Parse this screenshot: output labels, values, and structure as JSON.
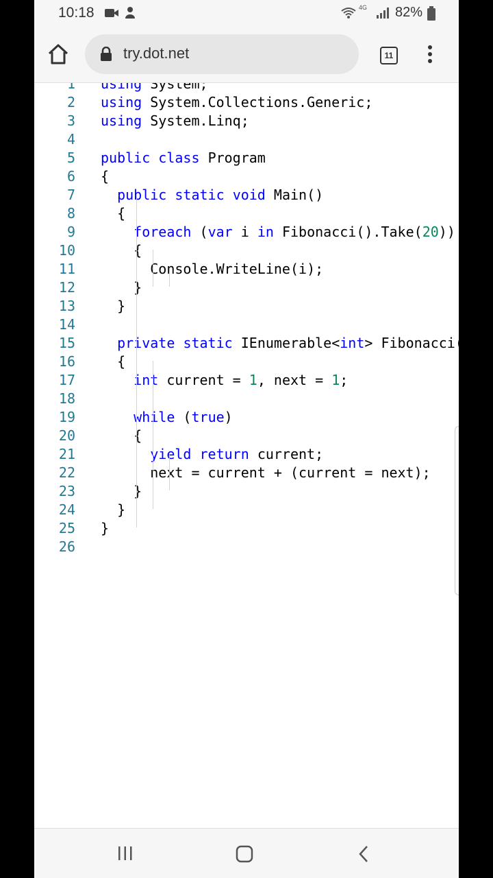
{
  "status_bar": {
    "time": "10:18",
    "battery_percent": "82%",
    "network_label": "4G"
  },
  "browser": {
    "url": "try.dot.net",
    "tab_count": "11"
  },
  "code": {
    "lines": [
      {
        "n": "1",
        "text": "using System;"
      },
      {
        "n": "2",
        "text": "using System.Collections.Generic;"
      },
      {
        "n": "3",
        "text": "using System.Linq;"
      },
      {
        "n": "4",
        "text": ""
      },
      {
        "n": "5",
        "text": "public class Program"
      },
      {
        "n": "6",
        "text": "{"
      },
      {
        "n": "7",
        "text": "  public static void Main()"
      },
      {
        "n": "8",
        "text": "  {"
      },
      {
        "n": "9",
        "text": "    foreach (var i in Fibonacci().Take(20))"
      },
      {
        "n": "10",
        "text": "    {"
      },
      {
        "n": "11",
        "text": "      Console.WriteLine(i);"
      },
      {
        "n": "12",
        "text": "    }"
      },
      {
        "n": "13",
        "text": "  }"
      },
      {
        "n": "14",
        "text": ""
      },
      {
        "n": "15",
        "text": "  private static IEnumerable<int> Fibonacci()"
      },
      {
        "n": "16",
        "text": "  {"
      },
      {
        "n": "17",
        "text": "    int current = 1, next = 1;"
      },
      {
        "n": "18",
        "text": ""
      },
      {
        "n": "19",
        "text": "    while (true)"
      },
      {
        "n": "20",
        "text": "    {"
      },
      {
        "n": "21",
        "text": "      yield return current;"
      },
      {
        "n": "22",
        "text": "      next = current + (current = next);"
      },
      {
        "n": "23",
        "text": "    }"
      },
      {
        "n": "24",
        "text": "  }"
      },
      {
        "n": "25",
        "text": "}"
      },
      {
        "n": "26",
        "text": ""
      }
    ],
    "keywords": [
      "using",
      "public",
      "class",
      "static",
      "void",
      "foreach",
      "var",
      "in",
      "private",
      "int",
      "while",
      "true",
      "yield",
      "return"
    ]
  },
  "colors": {
    "keyword": "#0000ff",
    "number": "#098658",
    "line_number": "#237893"
  }
}
